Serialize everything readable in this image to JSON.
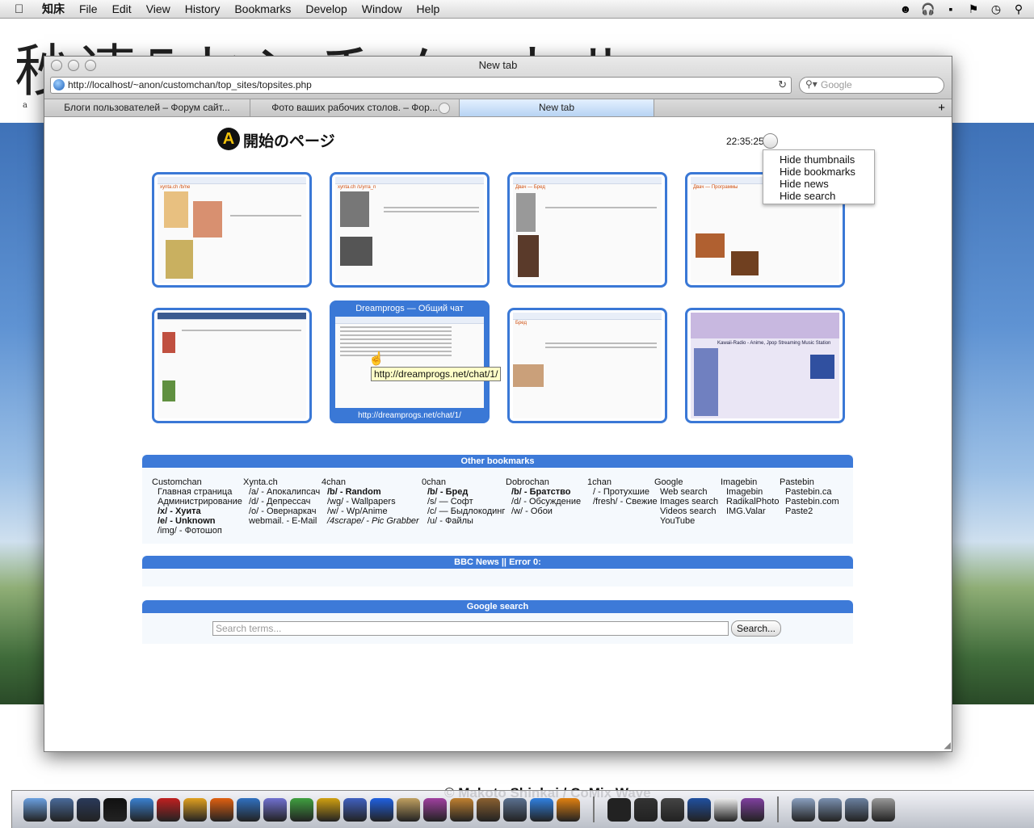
{
  "menubar": {
    "app_name": "知床",
    "items": [
      "File",
      "Edit",
      "View",
      "History",
      "Bookmarks",
      "Develop",
      "Window",
      "Help"
    ]
  },
  "wallpaper": {
    "title": "秒速5センチメートル",
    "subtitle": "a",
    "credit": "© Makoto Shinkai / CoMix Wave"
  },
  "window": {
    "title": "New tab",
    "url": "http://localhost/~anon/customchan/top_sites/topsites.php",
    "search_placeholder": "Google"
  },
  "tabs": [
    {
      "label": "Блоги пользователей – Форум сайт..."
    },
    {
      "label": "Фото ваших рабочих столов. – Фор..."
    },
    {
      "label": "New tab"
    }
  ],
  "page": {
    "heading": "開始のページ",
    "clock": "22:35:25",
    "options": [
      "Hide thumbnails",
      "Hide bookmarks",
      "Hide news",
      "Hide search"
    ]
  },
  "thumbnails": [
    {
      "title": "xynta.ch /b/ne"
    },
    {
      "title": "xynta.ch /s/yrra_n"
    },
    {
      "title": "Двач — Бред"
    },
    {
      "title": "Двач — Программы"
    },
    {
      "title": ""
    },
    {
      "title": "Dreamprogs — Общий чат",
      "url": "http://dreamprogs.net/chat/1/"
    },
    {
      "title": "Бред"
    },
    {
      "title": "Kawaii-Radio - Anime, Jpop Streaming Music Station"
    }
  ],
  "tooltip": "http://dreamprogs.net/chat/1/",
  "bookmarks": {
    "header": "Other bookmarks",
    "groups": [
      {
        "name": "Customchan",
        "links": [
          {
            "t": "Главная страница"
          },
          {
            "t": "Администрирование"
          },
          {
            "t": "/x/ - Хуита",
            "b": true
          },
          {
            "t": "/e/ - Unknown",
            "b": true
          },
          {
            "t": "/img/ - Фотошоп"
          }
        ]
      },
      {
        "name": "Xynta.ch",
        "links": [
          {
            "t": "/a/ - Апокалипсач"
          },
          {
            "t": "/d/ - Депрессач"
          },
          {
            "t": "/o/ - Овернаркач"
          },
          {
            "t": "webmail. - E-Mail"
          }
        ]
      },
      {
        "name": "4chan",
        "links": [
          {
            "t": "/b/ - Random",
            "b": true
          },
          {
            "t": "/wg/ - Wallpapers"
          },
          {
            "t": "/w/ - Wp/Anime"
          },
          {
            "t": "/4scrape/ - Pic Grabber",
            "i": true
          }
        ]
      },
      {
        "name": "0chan",
        "links": [
          {
            "t": "/b/ - Бред",
            "b": true
          },
          {
            "t": "/s/ — Софт"
          },
          {
            "t": "/c/ — Быдлокодинг"
          },
          {
            "t": "/u/ - Файлы"
          }
        ]
      },
      {
        "name": "Dobrochan",
        "links": [
          {
            "t": "/b/ - Братство",
            "b": true
          },
          {
            "t": "/d/ - Обсуждение"
          },
          {
            "t": "/w/ - Обои"
          }
        ]
      },
      {
        "name": "1chan",
        "links": [
          {
            "t": "/ - Протухшие"
          },
          {
            "t": "/fresh/ - Свежие"
          }
        ]
      },
      {
        "name": "Google",
        "links": [
          {
            "t": "Web search"
          },
          {
            "t": "Images search"
          },
          {
            "t": "Videos search"
          },
          {
            "t": "YouTube"
          }
        ]
      },
      {
        "name": "Imagebin",
        "links": [
          {
            "t": "Imagebin"
          },
          {
            "t": "RadikalPhoto"
          },
          {
            "t": "IMG.Valar"
          }
        ]
      },
      {
        "name": "Pastebin",
        "links": [
          {
            "t": "Pastebin.ca"
          },
          {
            "t": "Pastebin.com"
          },
          {
            "t": "Paste2"
          }
        ]
      }
    ]
  },
  "news": {
    "header": "BBC News || Error 0:"
  },
  "google_search": {
    "header": "Google search",
    "placeholder": "Search terms...",
    "button": "Search..."
  },
  "colors": {
    "accent": "#3d7ad8",
    "tab_active": "#b7d3f3",
    "tooltip_bg": "#ffffc8"
  },
  "dock_icons": [
    "finder-icon",
    "preview-icon",
    "dashboard-icon",
    "customchan-icon",
    "safari-icon",
    "opera-icon",
    "chrome-icon",
    "firefox-icon",
    "camino-icon",
    "pidgin-icon",
    "sync-icon",
    "clapper-icon",
    "adium-icon",
    "quicksilver-icon",
    "textedit-icon",
    "colorpicker-icon",
    "pencil-icon",
    "notebook-icon",
    "photo-icon",
    "itunes-icon",
    "vlc-icon",
    "terminal-icon",
    "activity-icon",
    "console-icon",
    "xcode-icon",
    "x11-icon",
    "ql-icon",
    "documents-icon",
    "applications-icon",
    "downloads-icon",
    "trash-icon"
  ]
}
